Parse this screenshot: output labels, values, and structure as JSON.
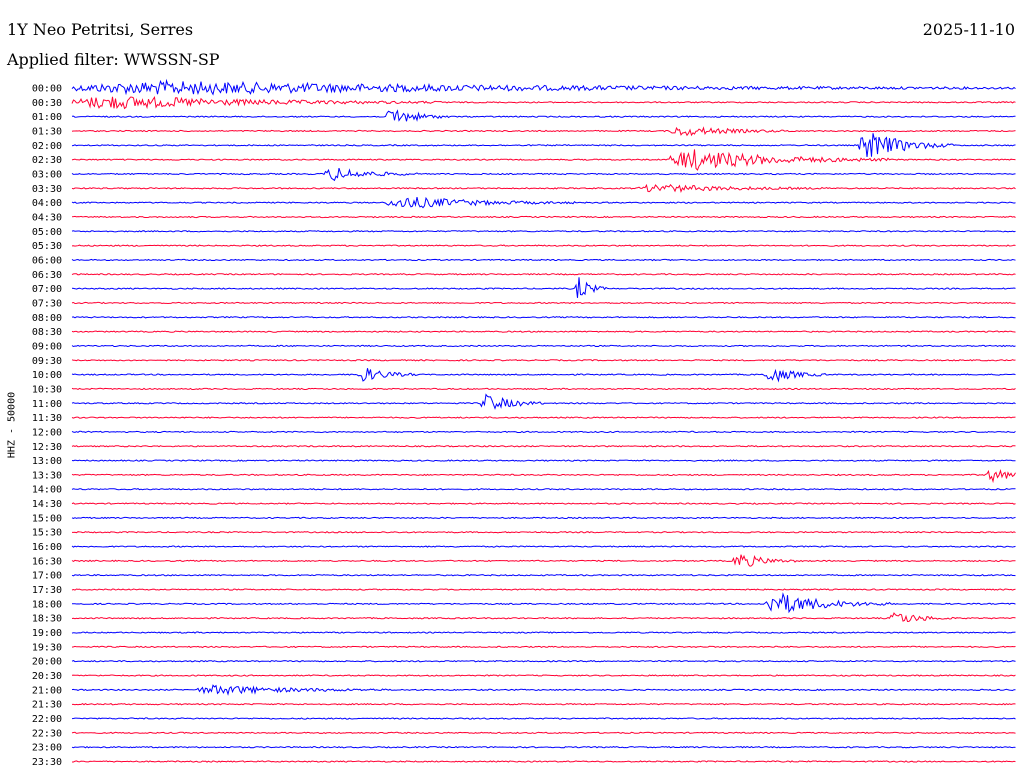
{
  "header": {
    "station": "1Y Neo Petritsi, Serres",
    "filter": "Applied filter: WWSSN-SP",
    "date": "2025-11-10"
  },
  "chart_data": {
    "type": "line",
    "title": "1Y Neo Petritsi, Serres",
    "subtitle": "Applied filter: WWSSN-SP",
    "date": "2025-11-10",
    "ylabel": "HHZ - 50000",
    "row_labels": [
      "00:00",
      "00:30",
      "01:00",
      "01:30",
      "02:00",
      "02:30",
      "03:00",
      "03:30",
      "04:00",
      "04:30",
      "05:00",
      "05:30",
      "06:00",
      "06:30",
      "07:00",
      "07:30",
      "08:00",
      "08:30",
      "09:00",
      "09:30",
      "10:00",
      "10:30",
      "11:00",
      "11:30",
      "12:00",
      "12:30",
      "13:00",
      "13:30",
      "14:00",
      "14:30",
      "15:00",
      "15:30",
      "16:00",
      "16:30",
      "17:00",
      "17:30",
      "18:00",
      "18:30",
      "19:00",
      "19:30",
      "20:00",
      "20:30",
      "21:00",
      "21:30",
      "22:00",
      "22:30",
      "23:00",
      "23:30"
    ],
    "row_minutes": 30,
    "series_colors": [
      "#0000ff",
      "#ff0033"
    ],
    "grid": false,
    "events_note": "approximate wiggle bursts per row, start/duration in minutes from row start, amp relative",
    "events": [
      {
        "row": 0,
        "start": 0,
        "dur": 30,
        "amp": 1.0
      },
      {
        "row": 1,
        "start": 0,
        "dur": 12,
        "amp": 1.0
      },
      {
        "row": 2,
        "start": 10,
        "dur": 2,
        "amp": 1.4
      },
      {
        "row": 3,
        "start": 19,
        "dur": 4,
        "amp": 0.7
      },
      {
        "row": 4,
        "start": 25,
        "dur": 3,
        "amp": 2.2
      },
      {
        "row": 5,
        "start": 19,
        "dur": 7,
        "amp": 1.6
      },
      {
        "row": 6,
        "start": 8,
        "dur": 3,
        "amp": 1.0
      },
      {
        "row": 7,
        "start": 18,
        "dur": 6,
        "amp": 0.6
      },
      {
        "row": 8,
        "start": 10,
        "dur": 6,
        "amp": 0.9
      },
      {
        "row": 13,
        "start": 30,
        "dur": 5,
        "amp": 0.7
      },
      {
        "row": 14,
        "start": 16,
        "dur": 1,
        "amp": 1.8
      },
      {
        "row": 20,
        "start": 9,
        "dur": 2,
        "amp": 1.2
      },
      {
        "row": 20,
        "start": 22,
        "dur": 2,
        "amp": 1.2
      },
      {
        "row": 22,
        "start": 13,
        "dur": 2,
        "amp": 1.4
      },
      {
        "row": 27,
        "start": 29,
        "dur": 2,
        "amp": 1.0
      },
      {
        "row": 33,
        "start": 21,
        "dur": 2,
        "amp": 1.2
      },
      {
        "row": 36,
        "start": 22,
        "dur": 4,
        "amp": 1.7
      },
      {
        "row": 37,
        "start": 26,
        "dur": 2,
        "amp": 1.0
      },
      {
        "row": 42,
        "start": 4,
        "dur": 6,
        "amp": 0.7
      }
    ]
  }
}
